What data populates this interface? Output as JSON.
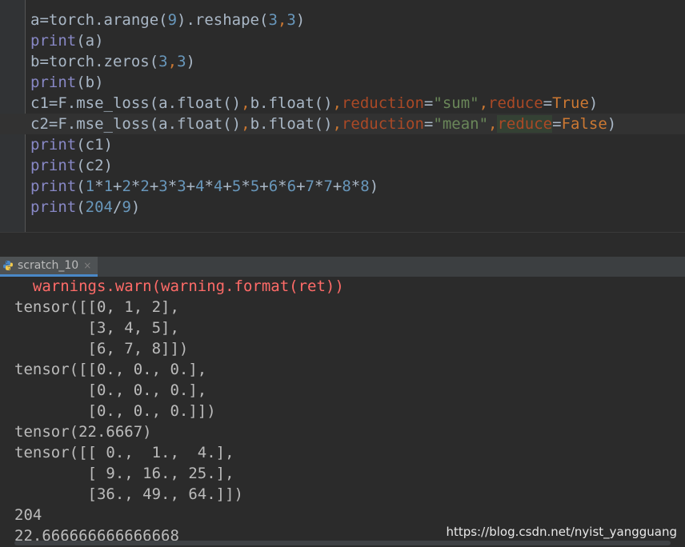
{
  "editor": {
    "lines": [
      {
        "code": "a=torch.arange(9).reshape(3,3)"
      },
      {
        "code": "print(a)"
      },
      {
        "code": "b=torch.zeros(3,3)"
      },
      {
        "code": "print(b)"
      },
      {
        "code": "c1=F.mse_loss(a.float(),b.float(),reduction=\"sum\",reduce=True)"
      },
      {
        "code": "c2=F.mse_loss(a.float(),b.float(),reduction=\"mean\",reduce=False)"
      },
      {
        "code": "print(c1)"
      },
      {
        "code": "print(c2)"
      },
      {
        "code": "print(1*1+2*2+3*3+4*4+5*5+6*6+7*7+8*8)"
      },
      {
        "code": "print(204/9)"
      }
    ]
  },
  "run_panel": {
    "tab_label": "scratch_10",
    "tab_close": "×",
    "tab_icon": "python-icon"
  },
  "console": {
    "lines": [
      "  warnings.warn(warning.format(ret))",
      "tensor([[0, 1, 2],",
      "        [3, 4, 5],",
      "        [6, 7, 8]])",
      "tensor([[0., 0., 0.],",
      "        [0., 0., 0.],",
      "        [0., 0., 0.]])",
      "tensor(22.6667)",
      "tensor([[ 0.,  1.,  4.],",
      "        [ 9., 16., 25.],",
      "        [36., 49., 64.]])",
      "204",
      "22.666666666666668"
    ]
  },
  "watermark": "https://blog.csdn.net/nyist_yangguang",
  "colors": {
    "background": "#2b2b2b",
    "default_text": "#a9b7c6",
    "builtin": "#8888c6",
    "number": "#6897bb",
    "string": "#6a8759",
    "keyword": "#cc7832",
    "param": "#aa4926",
    "warning": "#ff6b68",
    "tab_underline": "#4a88c7"
  }
}
